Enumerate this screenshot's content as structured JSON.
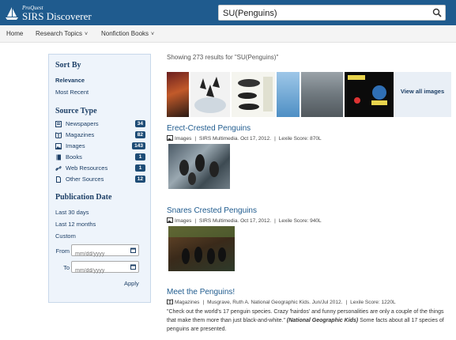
{
  "header": {
    "brand_small": "ProQuest",
    "brand": "SIRS Discoverer",
    "search_value": "SU(Penguins)",
    "accent": "#1f5b8e"
  },
  "nav": {
    "home": "Home",
    "research_topics": "Research Topics",
    "nonfiction_books": "Nonfiction Books",
    "chevron": "˅"
  },
  "sidebar": {
    "sort_by": "Sort By",
    "relevance": "Relevance",
    "most_recent": "Most Recent",
    "source_type": "Source Type",
    "sources": [
      {
        "label": "Newspapers",
        "count": "34",
        "icon": "newspaper-icon"
      },
      {
        "label": "Magazines",
        "count": "82",
        "icon": "magazine-icon"
      },
      {
        "label": "Images",
        "count": "143",
        "icon": "image-icon"
      },
      {
        "label": "Books",
        "count": "1",
        "icon": "book-icon"
      },
      {
        "label": "Web Resources",
        "count": "1",
        "icon": "link-icon"
      },
      {
        "label": "Other Sources",
        "count": "12",
        "icon": "document-icon"
      }
    ],
    "publication_date": "Publication Date",
    "last_30": "Last 30 days",
    "last_12": "Last 12 months",
    "custom": "Custom",
    "from": "From",
    "to": "To",
    "date_placeholder": "mm/dd/yyyy",
    "apply": "Apply"
  },
  "main": {
    "showing": "Showing 273 results for \"SU(Penguins)\"",
    "view_all": "View all images",
    "results": [
      {
        "title": "Erect-Crested Penguins",
        "type": "Images",
        "source": "SIRS Multimedia.",
        "date": "Oct 17, 2012.",
        "lexile": "Lexile Score: 870L"
      },
      {
        "title": "Snares Crested Penguins",
        "type": "Images",
        "source": "SIRS Multimedia.",
        "date": "Oct 17, 2012.",
        "lexile": "Lexile Score: 940L"
      },
      {
        "title": "Meet the Penguins!",
        "type": "Magazines",
        "source": "Musgrave, Ruth A.",
        "publication": "National Geographic Kids.",
        "date": "Jun/Jul 2012.",
        "lexile": "Lexile Score: 1220L",
        "snippet_pre": "\"Check out the world's 17 penguin species. Crazy 'hairdos' and funny personalities are only a couple of the things that make them more than just black-and-white.\"",
        "snippet_source": "(National Geographic Kids)",
        "snippet_post": "Some facts about all 17 species of penguins are presented."
      }
    ],
    "separator": "|"
  }
}
